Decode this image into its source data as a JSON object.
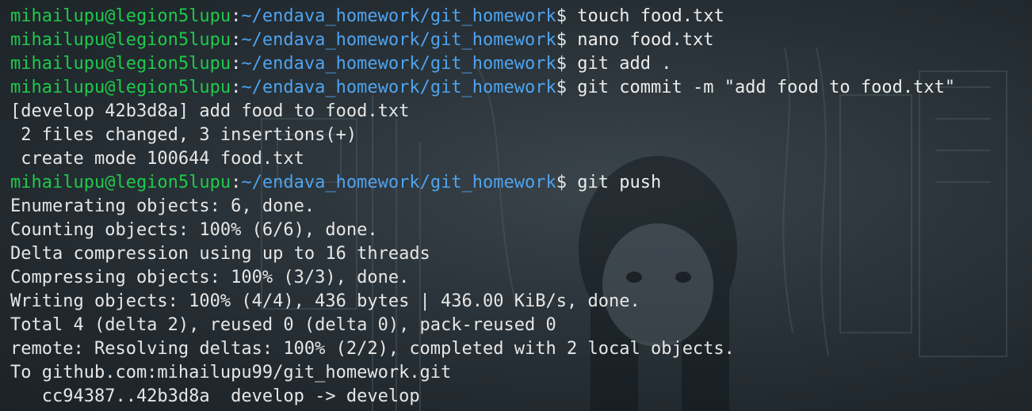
{
  "terminal": {
    "prompt_user": "mihailupu@legion5lupu",
    "prompt_sep": ":",
    "prompt_path": "~/endava_homework/git_homework",
    "prompt_symbol": "$",
    "colors": {
      "user": "#1fc94a",
      "path": "#4fa3ee",
      "text": "#e6e6e6",
      "background": "#1f272d"
    },
    "lines": [
      {
        "kind": "prompt",
        "command": " touch food.txt"
      },
      {
        "kind": "prompt",
        "command": " nano food.txt"
      },
      {
        "kind": "prompt",
        "command": " git add ."
      },
      {
        "kind": "prompt",
        "command": " git commit -m \"add food to food.txt\""
      },
      {
        "kind": "output",
        "text": "[develop 42b3d8a] add food to food.txt"
      },
      {
        "kind": "output",
        "text": " 2 files changed, 3 insertions(+)"
      },
      {
        "kind": "output",
        "text": " create mode 100644 food.txt"
      },
      {
        "kind": "prompt",
        "command": " git push"
      },
      {
        "kind": "output",
        "text": "Enumerating objects: 6, done."
      },
      {
        "kind": "output",
        "text": "Counting objects: 100% (6/6), done."
      },
      {
        "kind": "output",
        "text": "Delta compression using up to 16 threads"
      },
      {
        "kind": "output",
        "text": "Compressing objects: 100% (3/3), done."
      },
      {
        "kind": "output",
        "text": "Writing objects: 100% (4/4), 436 bytes | 436.00 KiB/s, done."
      },
      {
        "kind": "output",
        "text": "Total 4 (delta 2), reused 0 (delta 0), pack-reused 0"
      },
      {
        "kind": "output",
        "text": "remote: Resolving deltas: 100% (2/2), completed with 2 local objects."
      },
      {
        "kind": "output",
        "text": "To github.com:mihailupu99/git_homework.git"
      },
      {
        "kind": "output",
        "text": "   cc94387..42b3d8a  develop -> develop"
      }
    ]
  }
}
